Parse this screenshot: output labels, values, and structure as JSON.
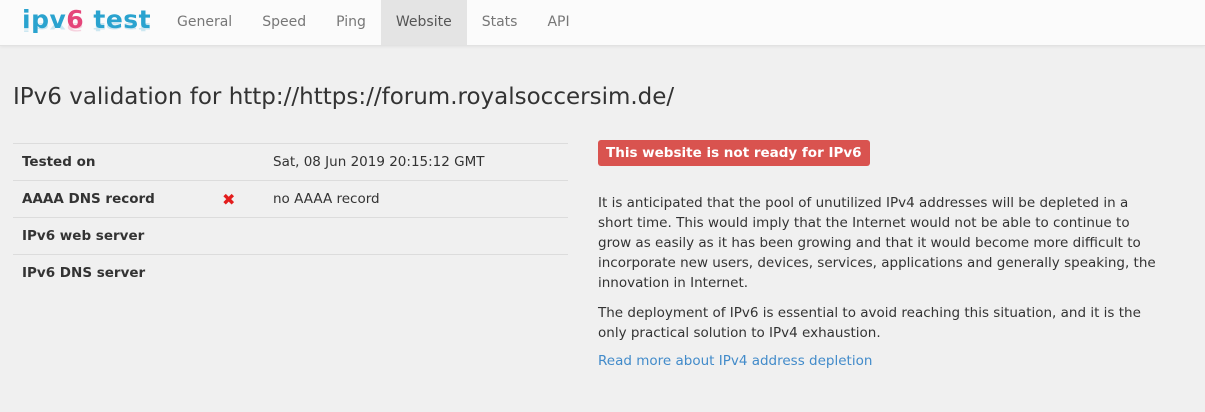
{
  "logo": {
    "part1": "ipv",
    "part2": "6",
    "part3": " test"
  },
  "nav": {
    "items": [
      {
        "label": "General"
      },
      {
        "label": "Speed"
      },
      {
        "label": "Ping"
      },
      {
        "label": "Website",
        "active": true
      },
      {
        "label": "Stats"
      },
      {
        "label": "API"
      }
    ]
  },
  "page": {
    "title": "IPv6 validation for http://https://forum.royalsoccersim.de/"
  },
  "results": {
    "rows": [
      {
        "label": "Tested on",
        "status_icon": "",
        "value": "Sat, 08 Jun 2019 20:15:12 GMT"
      },
      {
        "label": "AAAA DNS record",
        "status_icon": "✖",
        "value": "no AAAA record"
      },
      {
        "label": "IPv6 web server",
        "status_icon": "",
        "value": ""
      },
      {
        "label": "IPv6 DNS server",
        "status_icon": "",
        "value": ""
      }
    ]
  },
  "status_badge": {
    "text": "This website is not ready for IPv6",
    "color": "#d9534f"
  },
  "info": {
    "p1": "It is anticipated that the pool of unutilized IPv4 addresses will be depleted in a short time. This would imply that the Internet would not be able to continue to grow as easily as it has been growing and that it would become more difficult to incorporate new users, devices, services, applications and generally speaking, the innovation in Internet.",
    "p2": "The deployment of IPv6 is essential to avoid reaching this situation, and it is the only practical solution to IPv4 exhaustion.",
    "link": "Read more about IPv4 address depletion"
  },
  "icons": {
    "fail": "cross-icon"
  }
}
